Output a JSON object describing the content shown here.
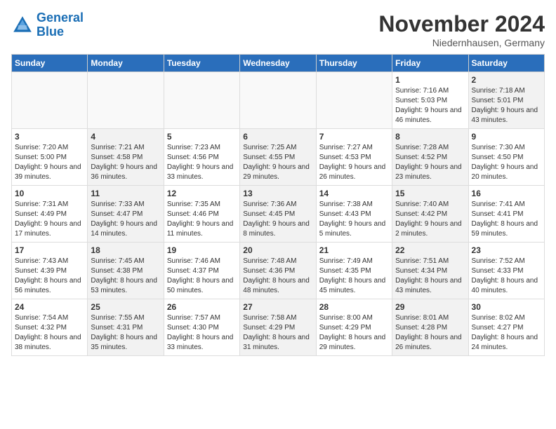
{
  "header": {
    "logo_line1": "General",
    "logo_line2": "Blue",
    "month": "November 2024",
    "location": "Niedernhausen, Germany"
  },
  "days_of_week": [
    "Sunday",
    "Monday",
    "Tuesday",
    "Wednesday",
    "Thursday",
    "Friday",
    "Saturday"
  ],
  "weeks": [
    [
      {
        "num": "",
        "sunrise": "",
        "sunset": "",
        "daylight": "",
        "empty": true
      },
      {
        "num": "",
        "sunrise": "",
        "sunset": "",
        "daylight": "",
        "empty": true
      },
      {
        "num": "",
        "sunrise": "",
        "sunset": "",
        "daylight": "",
        "empty": true
      },
      {
        "num": "",
        "sunrise": "",
        "sunset": "",
        "daylight": "",
        "empty": true
      },
      {
        "num": "",
        "sunrise": "",
        "sunset": "",
        "daylight": "",
        "empty": true
      },
      {
        "num": "1",
        "sunrise": "Sunrise: 7:16 AM",
        "sunset": "Sunset: 5:03 PM",
        "daylight": "Daylight: 9 hours and 46 minutes.",
        "empty": false,
        "shaded": false
      },
      {
        "num": "2",
        "sunrise": "Sunrise: 7:18 AM",
        "sunset": "Sunset: 5:01 PM",
        "daylight": "Daylight: 9 hours and 43 minutes.",
        "empty": false,
        "shaded": true
      }
    ],
    [
      {
        "num": "3",
        "sunrise": "Sunrise: 7:20 AM",
        "sunset": "Sunset: 5:00 PM",
        "daylight": "Daylight: 9 hours and 39 minutes.",
        "empty": false,
        "shaded": false
      },
      {
        "num": "4",
        "sunrise": "Sunrise: 7:21 AM",
        "sunset": "Sunset: 4:58 PM",
        "daylight": "Daylight: 9 hours and 36 minutes.",
        "empty": false,
        "shaded": true
      },
      {
        "num": "5",
        "sunrise": "Sunrise: 7:23 AM",
        "sunset": "Sunset: 4:56 PM",
        "daylight": "Daylight: 9 hours and 33 minutes.",
        "empty": false,
        "shaded": false
      },
      {
        "num": "6",
        "sunrise": "Sunrise: 7:25 AM",
        "sunset": "Sunset: 4:55 PM",
        "daylight": "Daylight: 9 hours and 29 minutes.",
        "empty": false,
        "shaded": true
      },
      {
        "num": "7",
        "sunrise": "Sunrise: 7:27 AM",
        "sunset": "Sunset: 4:53 PM",
        "daylight": "Daylight: 9 hours and 26 minutes.",
        "empty": false,
        "shaded": false
      },
      {
        "num": "8",
        "sunrise": "Sunrise: 7:28 AM",
        "sunset": "Sunset: 4:52 PM",
        "daylight": "Daylight: 9 hours and 23 minutes.",
        "empty": false,
        "shaded": true
      },
      {
        "num": "9",
        "sunrise": "Sunrise: 7:30 AM",
        "sunset": "Sunset: 4:50 PM",
        "daylight": "Daylight: 9 hours and 20 minutes.",
        "empty": false,
        "shaded": false
      }
    ],
    [
      {
        "num": "10",
        "sunrise": "Sunrise: 7:31 AM",
        "sunset": "Sunset: 4:49 PM",
        "daylight": "Daylight: 9 hours and 17 minutes.",
        "empty": false,
        "shaded": false
      },
      {
        "num": "11",
        "sunrise": "Sunrise: 7:33 AM",
        "sunset": "Sunset: 4:47 PM",
        "daylight": "Daylight: 9 hours and 14 minutes.",
        "empty": false,
        "shaded": true
      },
      {
        "num": "12",
        "sunrise": "Sunrise: 7:35 AM",
        "sunset": "Sunset: 4:46 PM",
        "daylight": "Daylight: 9 hours and 11 minutes.",
        "empty": false,
        "shaded": false
      },
      {
        "num": "13",
        "sunrise": "Sunrise: 7:36 AM",
        "sunset": "Sunset: 4:45 PM",
        "daylight": "Daylight: 9 hours and 8 minutes.",
        "empty": false,
        "shaded": true
      },
      {
        "num": "14",
        "sunrise": "Sunrise: 7:38 AM",
        "sunset": "Sunset: 4:43 PM",
        "daylight": "Daylight: 9 hours and 5 minutes.",
        "empty": false,
        "shaded": false
      },
      {
        "num": "15",
        "sunrise": "Sunrise: 7:40 AM",
        "sunset": "Sunset: 4:42 PM",
        "daylight": "Daylight: 9 hours and 2 minutes.",
        "empty": false,
        "shaded": true
      },
      {
        "num": "16",
        "sunrise": "Sunrise: 7:41 AM",
        "sunset": "Sunset: 4:41 PM",
        "daylight": "Daylight: 8 hours and 59 minutes.",
        "empty": false,
        "shaded": false
      }
    ],
    [
      {
        "num": "17",
        "sunrise": "Sunrise: 7:43 AM",
        "sunset": "Sunset: 4:39 PM",
        "daylight": "Daylight: 8 hours and 56 minutes.",
        "empty": false,
        "shaded": false
      },
      {
        "num": "18",
        "sunrise": "Sunrise: 7:45 AM",
        "sunset": "Sunset: 4:38 PM",
        "daylight": "Daylight: 8 hours and 53 minutes.",
        "empty": false,
        "shaded": true
      },
      {
        "num": "19",
        "sunrise": "Sunrise: 7:46 AM",
        "sunset": "Sunset: 4:37 PM",
        "daylight": "Daylight: 8 hours and 50 minutes.",
        "empty": false,
        "shaded": false
      },
      {
        "num": "20",
        "sunrise": "Sunrise: 7:48 AM",
        "sunset": "Sunset: 4:36 PM",
        "daylight": "Daylight: 8 hours and 48 minutes.",
        "empty": false,
        "shaded": true
      },
      {
        "num": "21",
        "sunrise": "Sunrise: 7:49 AM",
        "sunset": "Sunset: 4:35 PM",
        "daylight": "Daylight: 8 hours and 45 minutes.",
        "empty": false,
        "shaded": false
      },
      {
        "num": "22",
        "sunrise": "Sunrise: 7:51 AM",
        "sunset": "Sunset: 4:34 PM",
        "daylight": "Daylight: 8 hours and 43 minutes.",
        "empty": false,
        "shaded": true
      },
      {
        "num": "23",
        "sunrise": "Sunrise: 7:52 AM",
        "sunset": "Sunset: 4:33 PM",
        "daylight": "Daylight: 8 hours and 40 minutes.",
        "empty": false,
        "shaded": false
      }
    ],
    [
      {
        "num": "24",
        "sunrise": "Sunrise: 7:54 AM",
        "sunset": "Sunset: 4:32 PM",
        "daylight": "Daylight: 8 hours and 38 minutes.",
        "empty": false,
        "shaded": false
      },
      {
        "num": "25",
        "sunrise": "Sunrise: 7:55 AM",
        "sunset": "Sunset: 4:31 PM",
        "daylight": "Daylight: 8 hours and 35 minutes.",
        "empty": false,
        "shaded": true
      },
      {
        "num": "26",
        "sunrise": "Sunrise: 7:57 AM",
        "sunset": "Sunset: 4:30 PM",
        "daylight": "Daylight: 8 hours and 33 minutes.",
        "empty": false,
        "shaded": false
      },
      {
        "num": "27",
        "sunrise": "Sunrise: 7:58 AM",
        "sunset": "Sunset: 4:29 PM",
        "daylight": "Daylight: 8 hours and 31 minutes.",
        "empty": false,
        "shaded": true
      },
      {
        "num": "28",
        "sunrise": "Sunrise: 8:00 AM",
        "sunset": "Sunset: 4:29 PM",
        "daylight": "Daylight: 8 hours and 29 minutes.",
        "empty": false,
        "shaded": false
      },
      {
        "num": "29",
        "sunrise": "Sunrise: 8:01 AM",
        "sunset": "Sunset: 4:28 PM",
        "daylight": "Daylight: 8 hours and 26 minutes.",
        "empty": false,
        "shaded": true
      },
      {
        "num": "30",
        "sunrise": "Sunrise: 8:02 AM",
        "sunset": "Sunset: 4:27 PM",
        "daylight": "Daylight: 8 hours and 24 minutes.",
        "empty": false,
        "shaded": false
      }
    ]
  ]
}
